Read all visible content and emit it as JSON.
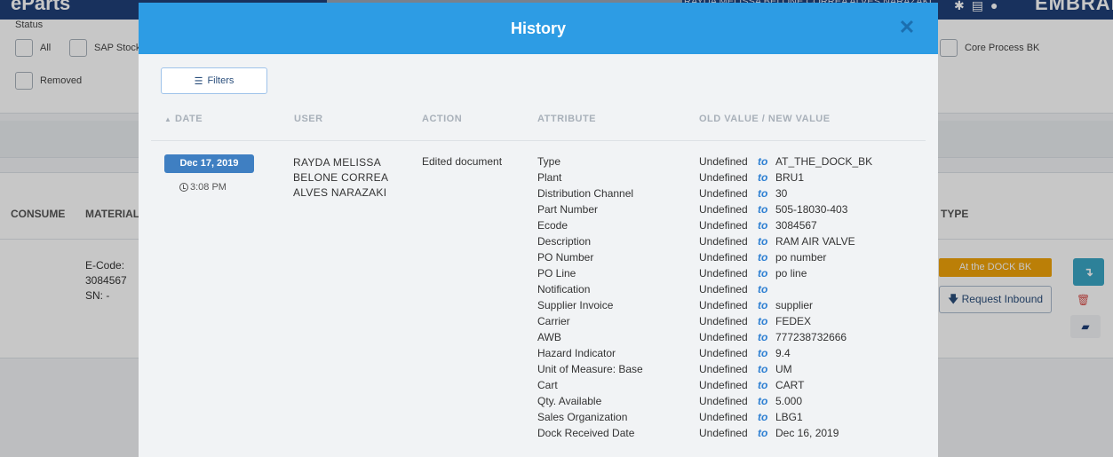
{
  "app": {
    "brand": "eParts",
    "user_display": "RAYDA MELISSA BELONE CORREA ALVES NARAZAKI",
    "brand_right": "EMBRAER"
  },
  "filters_panel": {
    "status_label": "Status",
    "checkboxes": [
      "All",
      "SAP Stock",
      "Removed",
      "Core Process BK"
    ]
  },
  "results": {
    "col_consume": "CONSUME",
    "col_material": "MATERIAL",
    "col_type": "TYPE",
    "ecode_label": "E-Code:",
    "ecode_value": "3084567",
    "sn": "SN: -",
    "type_badge": "At the DOCK BK",
    "request_inbound": "Request Inbound"
  },
  "modal": {
    "title": "History",
    "filters_button": "Filters",
    "columns": {
      "date": "DATE",
      "user": "USER",
      "action": "ACTION",
      "attribute": "ATTRIBUTE",
      "values": "OLD VALUE / NEW VALUE"
    },
    "entry": {
      "date": "Dec 17, 2019",
      "time": "3:08 PM",
      "user": "RAYDA MELISSA BELONE CORREA ALVES NARAZAKI",
      "action": "Edited document",
      "connector": "to",
      "changes": [
        {
          "attribute": "Type",
          "old": "Undefined",
          "new": "AT_THE_DOCK_BK"
        },
        {
          "attribute": "Plant",
          "old": "Undefined",
          "new": "BRU1"
        },
        {
          "attribute": "Distribution Channel",
          "old": "Undefined",
          "new": "30"
        },
        {
          "attribute": "Part Number",
          "old": "Undefined",
          "new": "505-18030-403"
        },
        {
          "attribute": "Ecode",
          "old": "Undefined",
          "new": "3084567"
        },
        {
          "attribute": "Description",
          "old": "Undefined",
          "new": "RAM AIR VALVE"
        },
        {
          "attribute": "PO Number",
          "old": "Undefined",
          "new": "po number"
        },
        {
          "attribute": "PO Line",
          "old": "Undefined",
          "new": "po line"
        },
        {
          "attribute": "Notification",
          "old": "Undefined",
          "new": ""
        },
        {
          "attribute": "Supplier Invoice",
          "old": "Undefined",
          "new": "supplier"
        },
        {
          "attribute": "Carrier",
          "old": "Undefined",
          "new": "FEDEX"
        },
        {
          "attribute": "AWB",
          "old": "Undefined",
          "new": "777238732666"
        },
        {
          "attribute": "Hazard Indicator",
          "old": "Undefined",
          "new": "9.4"
        },
        {
          "attribute": "Unit of Measure: Base",
          "old": "Undefined",
          "new": "UM"
        },
        {
          "attribute": "Cart",
          "old": "Undefined",
          "new": "CART"
        },
        {
          "attribute": "Qty. Available",
          "old": "Undefined",
          "new": "5.000"
        },
        {
          "attribute": "Sales Organization",
          "old": "Undefined",
          "new": "LBG1"
        },
        {
          "attribute": "Dock Received Date",
          "old": "Undefined",
          "new": "Dec 16, 2019"
        }
      ]
    }
  }
}
